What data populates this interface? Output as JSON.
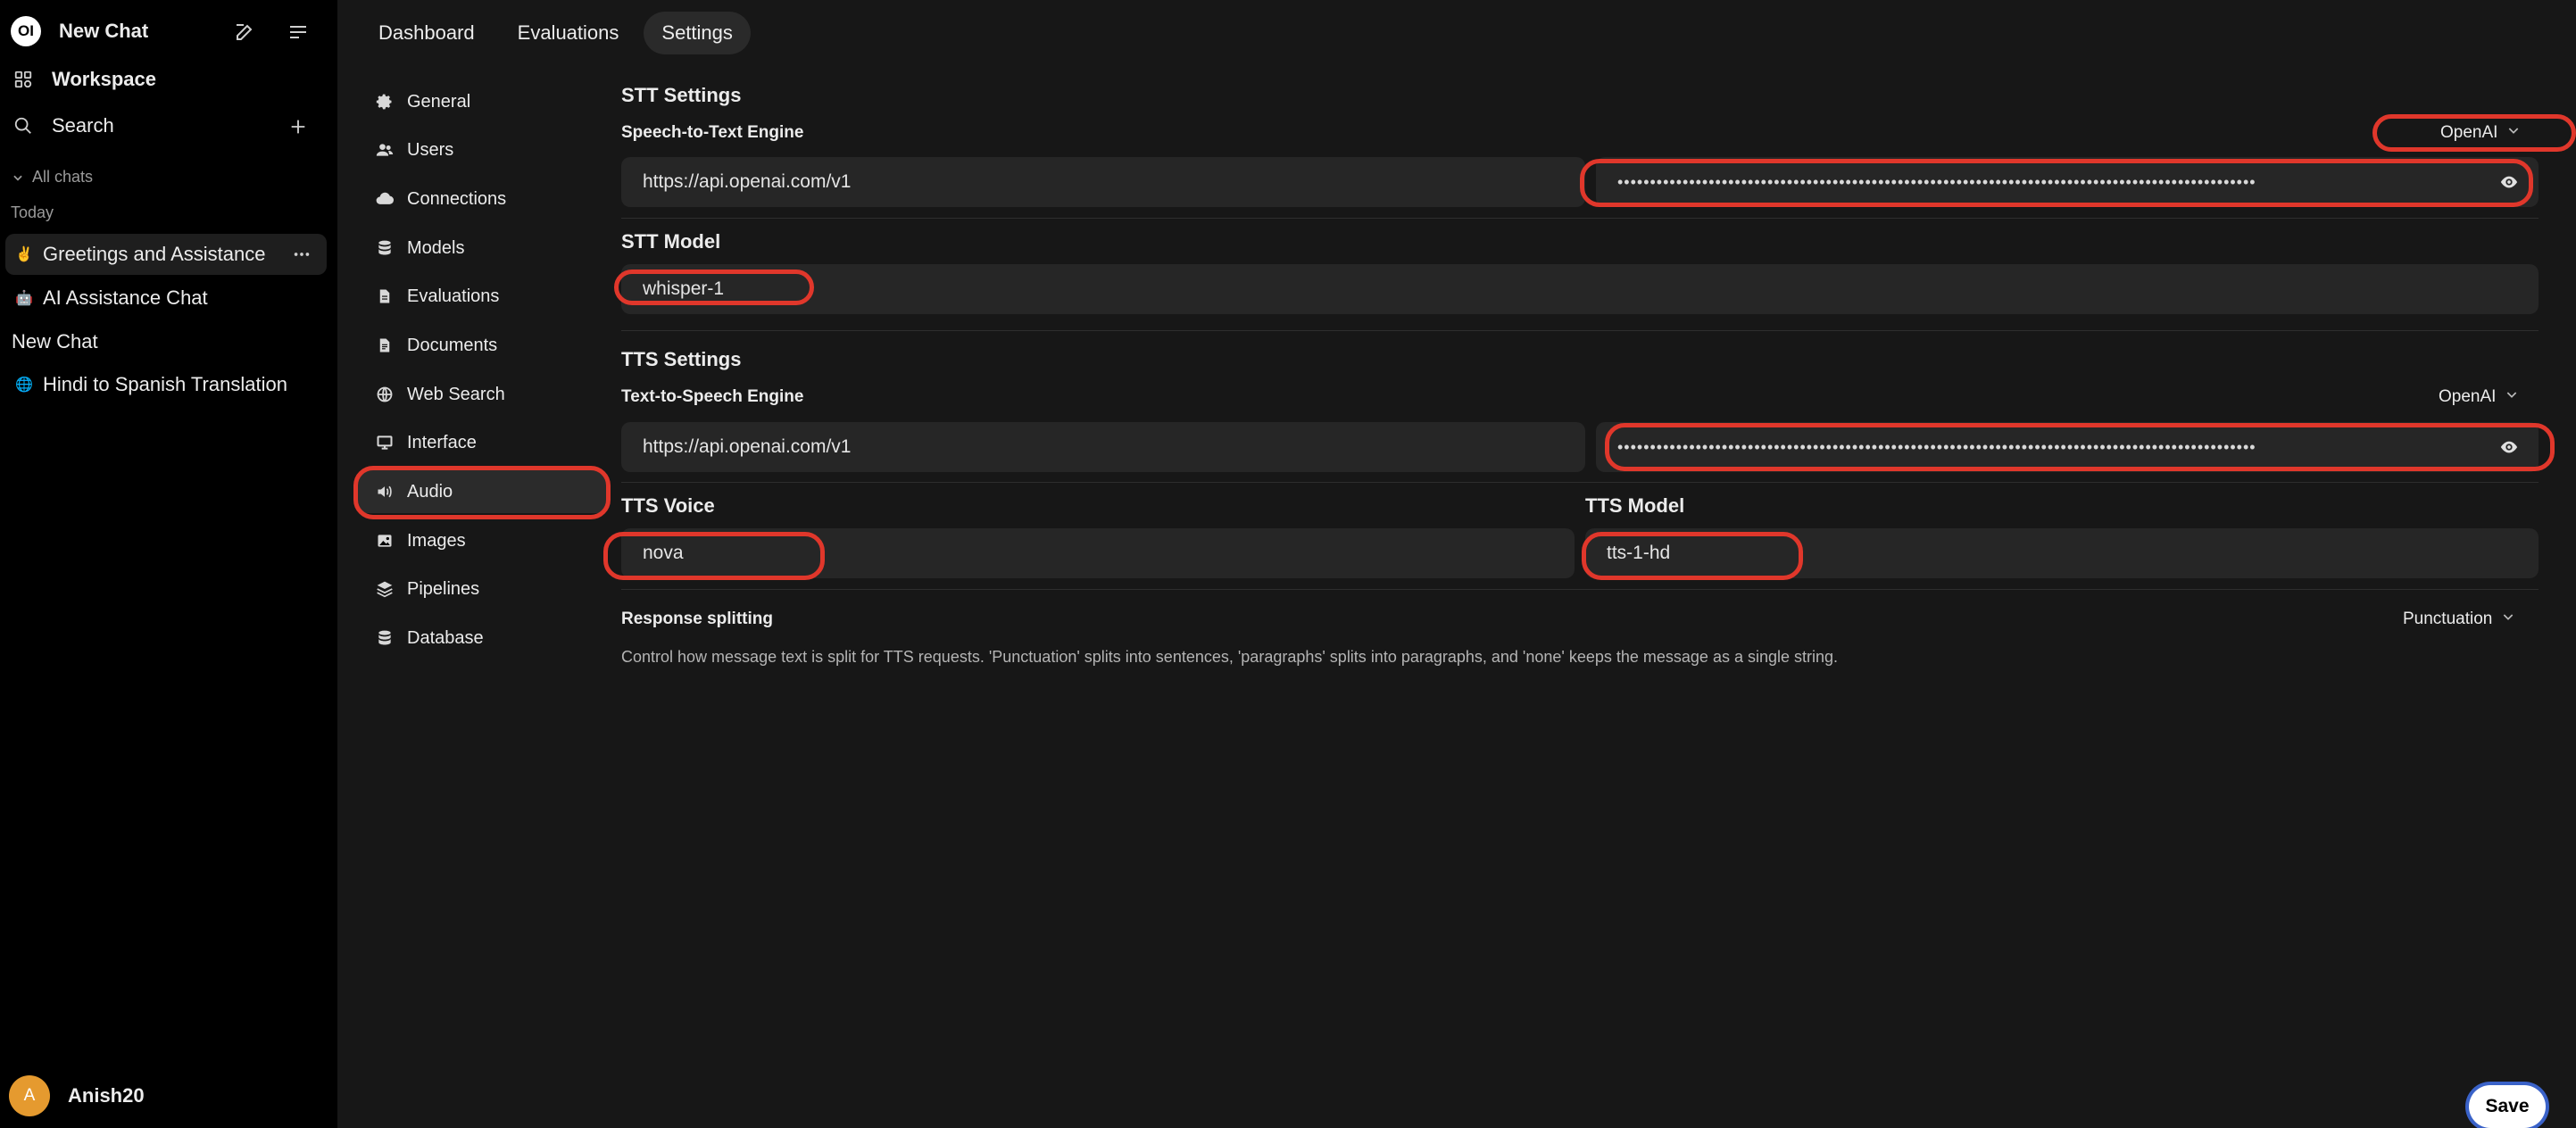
{
  "sidebar": {
    "new_chat": "New Chat",
    "logo_text": "OI",
    "workspace": "Workspace",
    "search": "Search",
    "all_chats": "All chats",
    "today": "Today",
    "chats": [
      {
        "emoji": "✌️",
        "title": "Greetings and Assistance"
      },
      {
        "emoji": "🤖",
        "title": "AI Assistance Chat"
      },
      {
        "emoji": "",
        "title": "New Chat"
      },
      {
        "emoji": "🌐",
        "title": "Hindi to Spanish Translation"
      }
    ],
    "user": {
      "initial": "A",
      "name": "Anish20"
    }
  },
  "topnav": {
    "tabs": [
      "Dashboard",
      "Evaluations",
      "Settings"
    ],
    "active": "Settings"
  },
  "settings_nav": {
    "items": [
      "General",
      "Users",
      "Connections",
      "Models",
      "Evaluations",
      "Documents",
      "Web Search",
      "Interface",
      "Audio",
      "Images",
      "Pipelines",
      "Database"
    ],
    "active": "Audio"
  },
  "audio": {
    "stt_title": "STT Settings",
    "stt_engine_label": "Speech-to-Text Engine",
    "stt_engine_value": "OpenAI",
    "stt_url": "https://api.openai.com/v1",
    "stt_key_masked": "••••••••••••••••••••••••••••••••••••••••••••••••••••••••••••••••••••••••••••••••••••••••••••••••••",
    "stt_model_title": "STT Model",
    "stt_model_value": "whisper-1",
    "tts_title": "TTS Settings",
    "tts_engine_label": "Text-to-Speech Engine",
    "tts_engine_value": "OpenAI",
    "tts_url": "https://api.openai.com/v1",
    "tts_key_masked": "••••••••••••••••••••••••••••••••••••••••••••••••••••••••••••••••••••••••••••••••••••••••••••••••••",
    "tts_voice_title": "TTS Voice",
    "tts_voice_value": "nova",
    "tts_model_title": "TTS Model",
    "tts_model_value": "tts-1-hd",
    "response_splitting_label": "Response splitting",
    "response_splitting_value": "Punctuation",
    "response_splitting_desc": "Control how message text is split for TTS requests. 'Punctuation' splits into sentences, 'paragraphs' splits into paragraphs, and 'none' keeps the message as a single string."
  },
  "save_label": "Save",
  "colors": {
    "highlight": "#e0372b",
    "avatar": "#e59a2f",
    "background": "#171717",
    "sidebar": "#000000"
  }
}
